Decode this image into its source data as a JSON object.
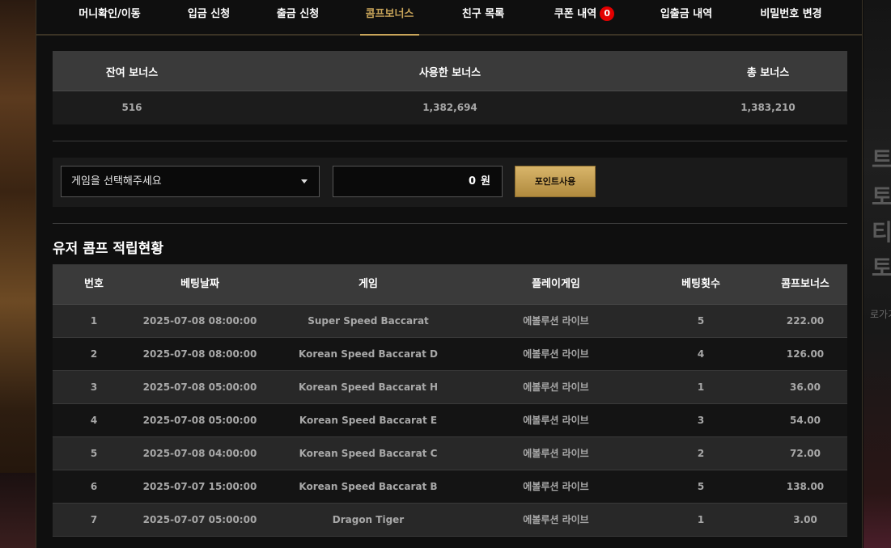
{
  "tabs": [
    {
      "label": "머니확인/이동"
    },
    {
      "label": "입금 신청"
    },
    {
      "label": "출금 신청"
    },
    {
      "label": "콤프보너스"
    },
    {
      "label": "친구 목록"
    },
    {
      "label": "쿠폰 내역",
      "badge": "0"
    },
    {
      "label": "입출금 내역"
    },
    {
      "label": "비밀번호 변경"
    }
  ],
  "active_tab": "콤프보너스",
  "summary": {
    "headers": [
      "잔여 보너스",
      "사용한 보너스",
      "총 보너스"
    ],
    "values": [
      "516",
      "1,382,694",
      "1,383,210"
    ]
  },
  "controls": {
    "select_placeholder": "게임을 선택해주세요",
    "amount_value": "0",
    "amount_unit": "원",
    "use_button": "포인트사용"
  },
  "section_title": "유저 콤프 적립현황",
  "comp_table": {
    "headers": [
      "번호",
      "베팅날짜",
      "게임",
      "플레이게임",
      "베팅횟수",
      "콤프보너스"
    ],
    "rows": [
      [
        "1",
        "2025-07-08 08:00:00",
        "Super Speed Baccarat",
        "에볼루션 라이브",
        "5",
        "222.00"
      ],
      [
        "2",
        "2025-07-08 08:00:00",
        "Korean Speed Baccarat D",
        "에볼루션 라이브",
        "4",
        "126.00"
      ],
      [
        "3",
        "2025-07-08 05:00:00",
        "Korean Speed Baccarat H",
        "에볼루션 라이브",
        "1",
        "36.00"
      ],
      [
        "4",
        "2025-07-08 05:00:00",
        "Korean Speed Baccarat E",
        "에볼루션 라이브",
        "3",
        "54.00"
      ],
      [
        "5",
        "2025-07-08 04:00:00",
        "Korean Speed Baccarat C",
        "에볼루션 라이브",
        "2",
        "72.00"
      ],
      [
        "6",
        "2025-07-07 15:00:00",
        "Korean Speed Baccarat B",
        "에볼루션 라이브",
        "5",
        "138.00"
      ],
      [
        "7",
        "2025-07-07 05:00:00",
        "Dragon Tiger",
        "에볼루션 라이브",
        "1",
        "3.00"
      ]
    ]
  },
  "background_text": {
    "right_glyphs": [
      "트",
      "토",
      "티",
      "토"
    ],
    "right_small": "로가기"
  },
  "colors": {
    "accent_gold": "#c9a55a",
    "badge_red": "#e30000",
    "button_gold": "#d8b56a"
  }
}
